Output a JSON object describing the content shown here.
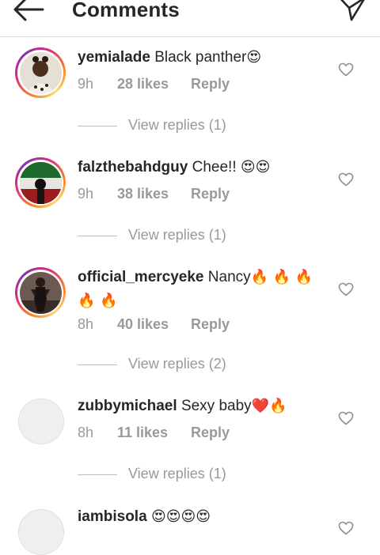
{
  "header": {
    "title": "Comments"
  },
  "comments": [
    {
      "username": "yemialade",
      "text": "Black panther",
      "emojis": "😍",
      "time": "9h",
      "likes": "28 likes",
      "reply": "Reply",
      "view_replies": "View replies (1)"
    },
    {
      "username": "falzthebahdguy",
      "text": "Chee!!",
      "emojis": "😍😍",
      "time": "9h",
      "likes": "38 likes",
      "reply": "Reply",
      "view_replies": "View replies (1)"
    },
    {
      "username": "official_mercyeke",
      "text": "Nancy",
      "emojis": "🔥 🔥 🔥",
      "emojis2": "🔥 🔥",
      "time": "8h",
      "likes": "40 likes",
      "reply": "Reply",
      "view_replies": "View replies (2)"
    },
    {
      "username": "zubbymichael",
      "text": "Sexy baby",
      "emojis": "❤️🔥",
      "time": "8h",
      "likes": "11 likes",
      "reply": "Reply",
      "view_replies": "View replies (1)"
    },
    {
      "username": "iambisola",
      "text": "",
      "emojis": "😍😍😍😍"
    }
  ]
}
